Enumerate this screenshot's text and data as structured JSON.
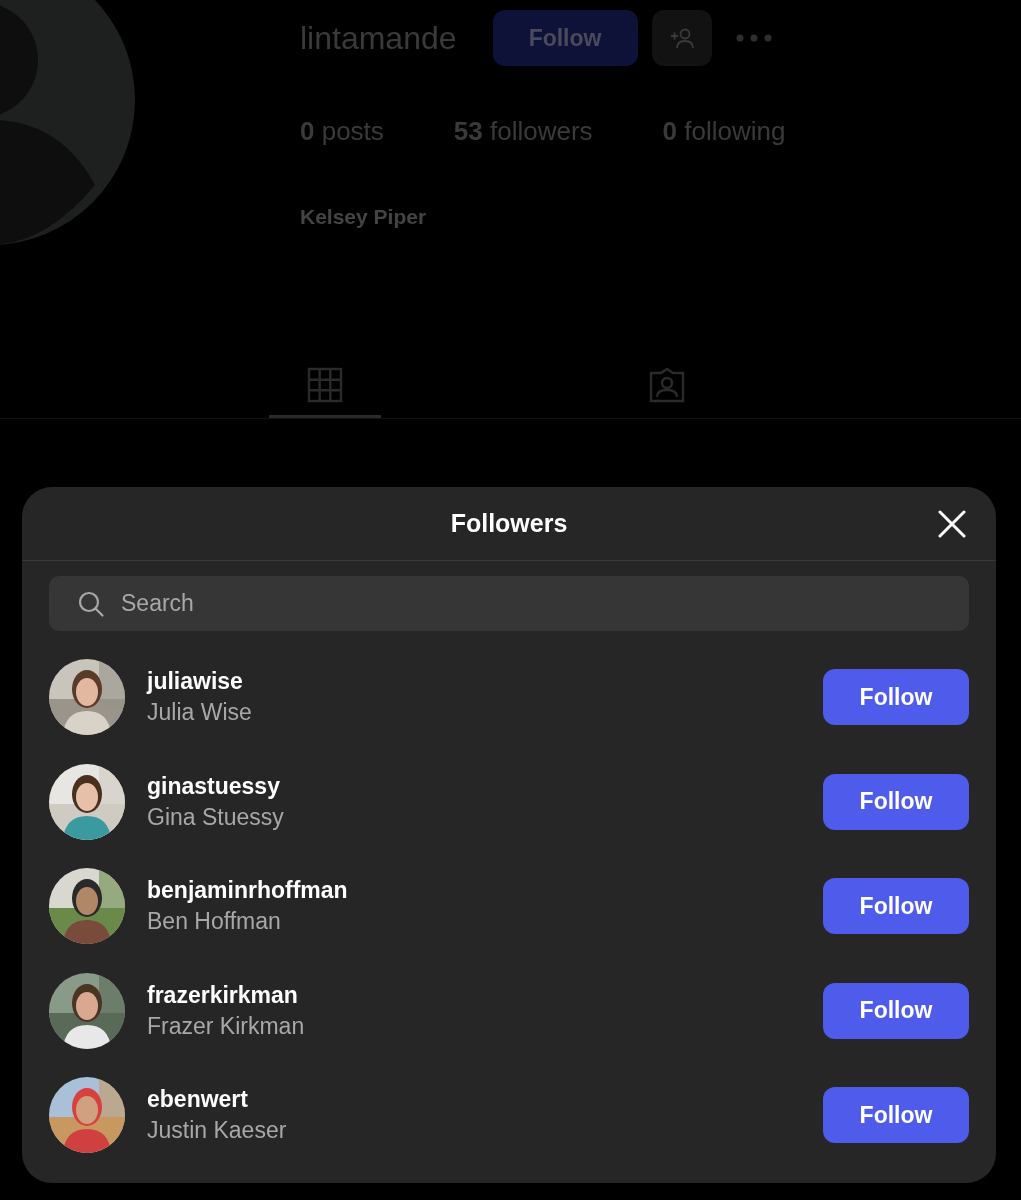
{
  "profile": {
    "username": "lintamande",
    "follow_button": "Follow",
    "stats": [
      {
        "text": "**0** posts"
      },
      {
        "text": "**53** followers"
      },
      {
        "text": "**0** following"
      }
    ],
    "full_name": "Kelsey Piper",
    "tabs": [
      {
        "kind": "grid",
        "selected": true
      },
      {
        "kind": "tagged",
        "selected": false
      }
    ]
  },
  "dialog": {
    "title": "Followers",
    "search": {
      "placeholder": "Search"
    },
    "followers": [
      {
        "username": "juliawise",
        "name": "Julia Wise",
        "button": "Follow"
      },
      {
        "username": "ginastuessy",
        "name": "Gina Stuessy",
        "button": "Follow"
      },
      {
        "username": "benjaminrhoffman",
        "name": "Ben Hoffman",
        "button": "Follow"
      },
      {
        "username": "frazerkirkman",
        "name": "Frazer Kirkman",
        "button": "Follow"
      },
      {
        "username": "ebenwert",
        "name": "Justin Kaeser",
        "button": "Follow"
      }
    ]
  }
}
